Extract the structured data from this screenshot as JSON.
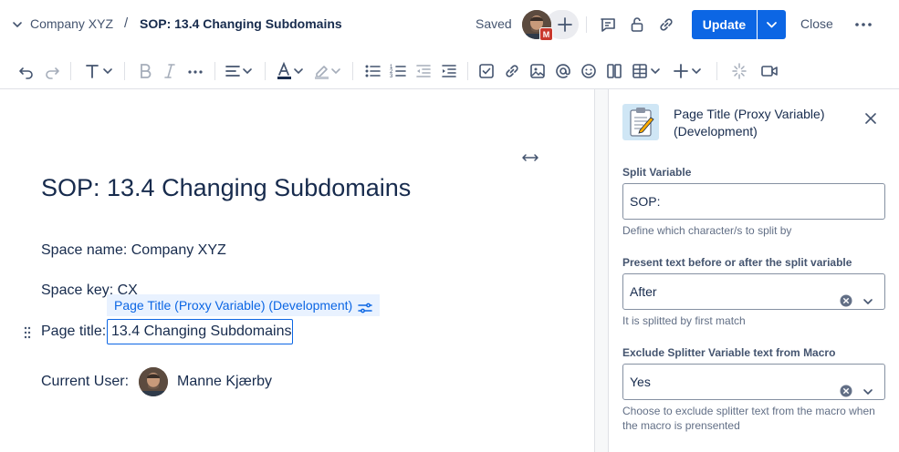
{
  "header": {
    "space_name": "Company XYZ",
    "separator": "/",
    "page_title": "SOP: 13.4 Changing Subdomains",
    "status": "Saved",
    "avatar_badge": "M",
    "update_label": "Update",
    "close_label": "Close"
  },
  "toolbar": {
    "icons": [
      "undo-icon",
      "redo-icon",
      "text-style-icon",
      "bold-icon",
      "italic-icon",
      "more-formatting-icon",
      "align-icon",
      "text-color-icon",
      "highlight-icon",
      "bullet-list-icon",
      "numbered-list-icon",
      "outdent-icon",
      "indent-icon",
      "task-icon",
      "link-icon",
      "image-icon",
      "mention-icon",
      "emoji-icon",
      "layout-icon",
      "table-icon",
      "insert-icon",
      "ai-icon",
      "video-icon"
    ]
  },
  "document": {
    "title": "SOP: 13.4 Changing Subdomains",
    "space_name_label": "Space name:",
    "space_name_value": "Company XYZ",
    "space_key_label": "Space key:",
    "space_key_value": "CX",
    "page_title_label": "Page title:",
    "page_title_value": "13.4 Changing Subdomains",
    "current_user_label": "Current User:",
    "current_user_name": "Manne Kjærby",
    "macro_tag": "Page Title (Proxy Variable) (Development)"
  },
  "panel": {
    "title": "Page Title (Proxy Variable) (Development)",
    "fields": {
      "split_variable": {
        "label": "Split Variable",
        "value": "SOP:",
        "help": "Define which character/s to split by"
      },
      "present_text": {
        "label": "Present text before or after the split variable",
        "value": "After",
        "help": "It is splitted by first match"
      },
      "exclude_splitter": {
        "label": "Exclude Splitter Variable text from Macro",
        "value": "Yes",
        "help": "Choose to exclude splitter text from the macro when the macro is prensented"
      }
    }
  },
  "colors": {
    "accent": "#0c66e4",
    "text": "#172b4d",
    "subtle": "#44546f",
    "badge": "#c9372c"
  }
}
